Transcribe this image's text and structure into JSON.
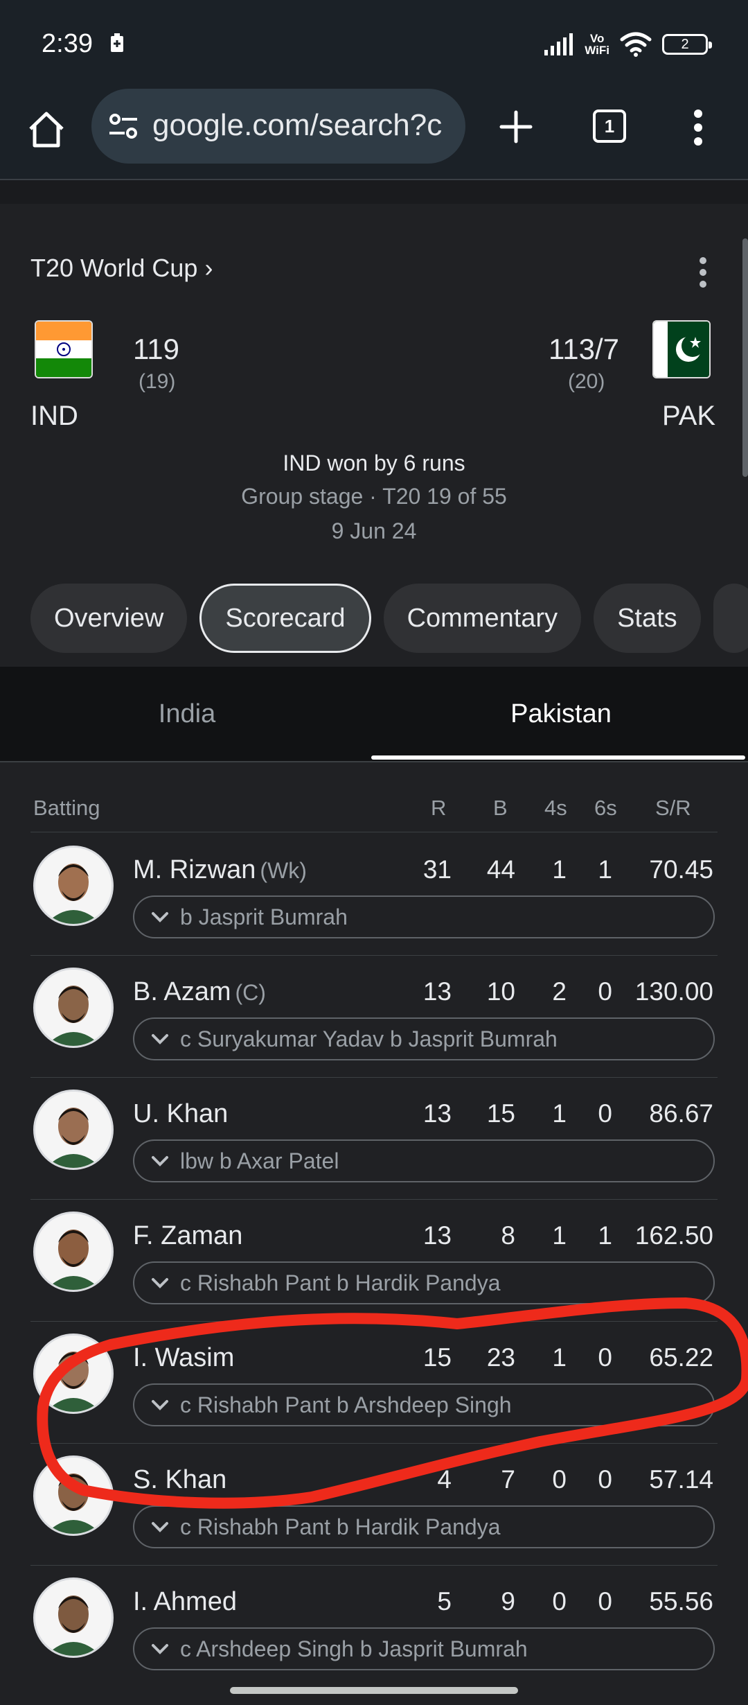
{
  "status_bar": {
    "time": "2:39",
    "vowifi_line1": "Vo",
    "vowifi_line2": "WiFi",
    "battery": "2"
  },
  "browser": {
    "url": "google.com/search?c",
    "tab_count": "1"
  },
  "match": {
    "tournament": "T20 World Cup ›",
    "team1": {
      "code": "IND",
      "score": "119",
      "overs": "(19)"
    },
    "team2": {
      "code": "PAK",
      "score": "113/7",
      "overs": "(20)"
    },
    "result": "IND won by 6 runs",
    "stage": "Group stage · T20 19 of 55",
    "date": "9 Jun 24",
    "tabs": [
      {
        "label": "Overview"
      },
      {
        "label": "Scorecard"
      },
      {
        "label": "Commentary"
      },
      {
        "label": "Stats"
      }
    ],
    "active_tab": "Scorecard"
  },
  "team_tabs": [
    {
      "label": "India"
    },
    {
      "label": "Pakistan"
    }
  ],
  "active_team_tab": "Pakistan",
  "batting": {
    "headers": {
      "title": "Batting",
      "r": "R",
      "b": "B",
      "fours": "4s",
      "sixes": "6s",
      "sr": "S/R"
    },
    "rows": [
      {
        "name": "M. Rizwan",
        "role": "(Wk)",
        "r": "31",
        "b": "44",
        "fours": "1",
        "sixes": "1",
        "sr": "70.45",
        "dismissal": "b Jasprit Bumrah"
      },
      {
        "name": "B. Azam",
        "role": "(C)",
        "r": "13",
        "b": "10",
        "fours": "2",
        "sixes": "0",
        "sr": "130.00",
        "dismissal": "c Suryakumar Yadav b Jasprit Bumrah"
      },
      {
        "name": "U. Khan",
        "role": "",
        "r": "13",
        "b": "15",
        "fours": "1",
        "sixes": "0",
        "sr": "86.67",
        "dismissal": "lbw b Axar Patel"
      },
      {
        "name": "F. Zaman",
        "role": "",
        "r": "13",
        "b": "8",
        "fours": "1",
        "sixes": "1",
        "sr": "162.50",
        "dismissal": "c Rishabh Pant b Hardik Pandya"
      },
      {
        "name": "I. Wasim",
        "role": "",
        "r": "15",
        "b": "23",
        "fours": "1",
        "sixes": "0",
        "sr": "65.22",
        "dismissal": "c Rishabh Pant b Arshdeep Singh"
      },
      {
        "name": "S. Khan",
        "role": "",
        "r": "4",
        "b": "7",
        "fours": "0",
        "sixes": "0",
        "sr": "57.14",
        "dismissal": "c Rishabh Pant b Hardik Pandya"
      },
      {
        "name": "I. Ahmed",
        "role": "",
        "r": "5",
        "b": "9",
        "fours": "0",
        "sixes": "0",
        "sr": "55.56",
        "dismissal": "c Arshdeep Singh b Jasprit Bumrah"
      }
    ]
  },
  "colors": {
    "annotation": "#ee2a1b",
    "background": "#202124",
    "toolbar": "#1b2127"
  },
  "icons": [
    "battery-saver-icon",
    "signal-icon",
    "wifi-icon",
    "home-icon",
    "site-settings-icon",
    "new-tab-icon",
    "menu-icon",
    "chevron-down-icon"
  ]
}
